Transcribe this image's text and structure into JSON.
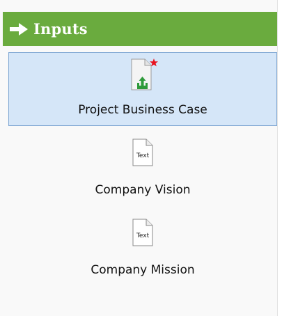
{
  "panel": {
    "header": {
      "title": "Inputs",
      "icon": "arrow-right-icon",
      "color": "#6aab3e"
    },
    "items": [
      {
        "label": "Project Business Case",
        "icon": "document-upload-required-icon",
        "selected": true,
        "required": true
      },
      {
        "label": "Company Vision",
        "icon": "text-document-icon",
        "icon_text": "Text",
        "selected": false
      },
      {
        "label": "Company Mission",
        "icon": "text-document-icon",
        "icon_text": "Text",
        "selected": false
      }
    ],
    "selection_color": "#d5e6f8",
    "required_marker_color": "#e8121e"
  }
}
